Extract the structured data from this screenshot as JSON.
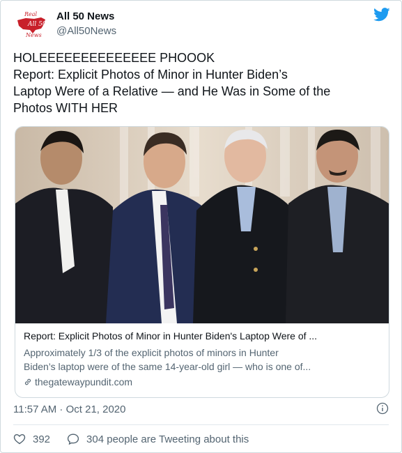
{
  "author": {
    "display_name": "All 50 News",
    "handle": "@All50News"
  },
  "tweet": {
    "lines": [
      "HOLEEEEEEEEEEEEEE PHOOOK",
      "Report: Explicit Photos of Minor in Hunter Biden’s",
      "Laptop Were of a Relative — and He Was in Some of the",
      "Photos WITH HER"
    ]
  },
  "link_card": {
    "title": "Report: Explicit Photos of Minor in Hunter Biden's Laptop Were of ...",
    "description_lines": [
      "Approximately 1/3 of the explicit photos of minors in Hunter",
      "Biden’s laptop were of the same 14-year-old girl — who is one of..."
    ],
    "domain": "thegatewaypundit.com"
  },
  "timestamp": "11:57 AM · Oct 21, 2020",
  "actions": {
    "likes": "392",
    "replies_label": "304 people are Tweeting about this"
  },
  "icons": {
    "brand": "twitter-bird-icon",
    "info": "info-icon",
    "like": "heart-icon",
    "reply": "speech-bubble-icon",
    "link": "link-icon"
  },
  "colors": {
    "twitter_blue": "#1d9bf0",
    "secondary_text": "#536471"
  }
}
